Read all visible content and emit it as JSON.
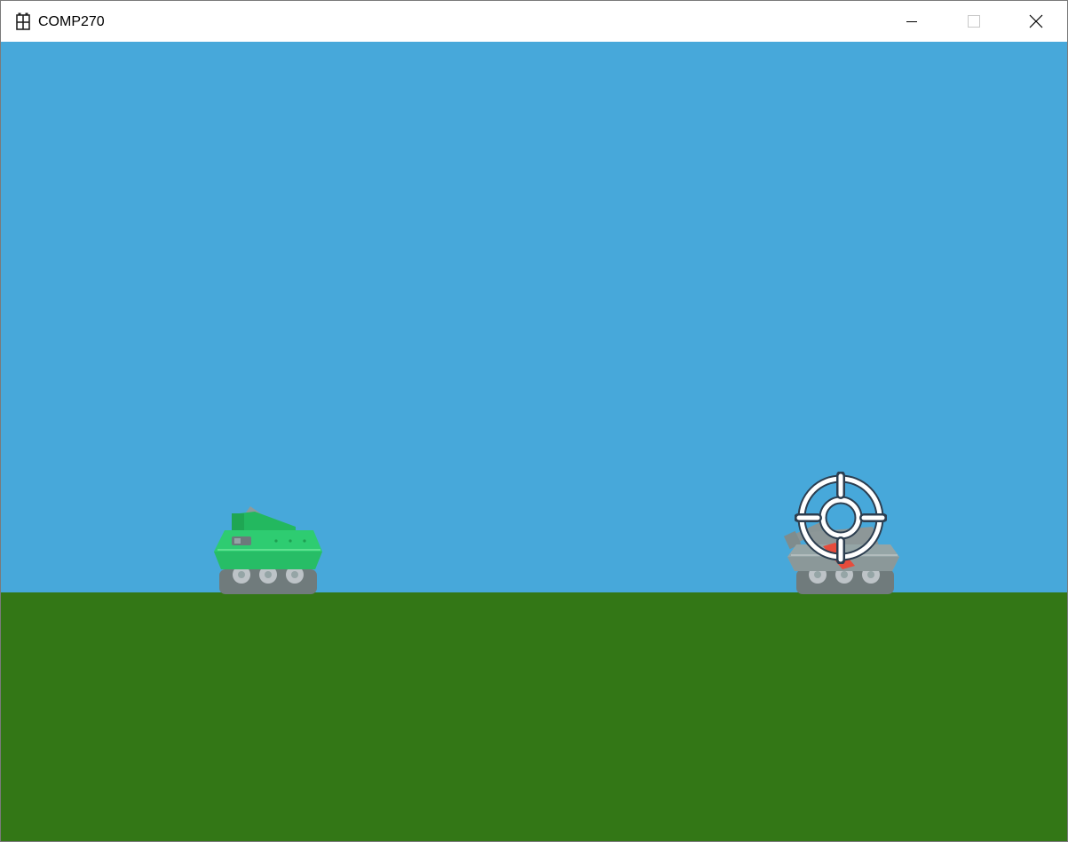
{
  "window": {
    "title": "COMP270",
    "icon": "app-grid-icon",
    "controls": {
      "minimize_icon": "minimize-icon",
      "maximize_icon": "maximize-icon",
      "close_icon": "close-icon"
    }
  },
  "scene": {
    "sky_color": "#47a8da",
    "ground_color": "#337716",
    "player_tank": {
      "icon": "green-tank-icon",
      "color": "#2ecc71"
    },
    "enemy_tank": {
      "icon": "gray-tank-icon",
      "color": "#95a5a6"
    },
    "crosshair": {
      "icon": "crosshair-icon"
    }
  }
}
